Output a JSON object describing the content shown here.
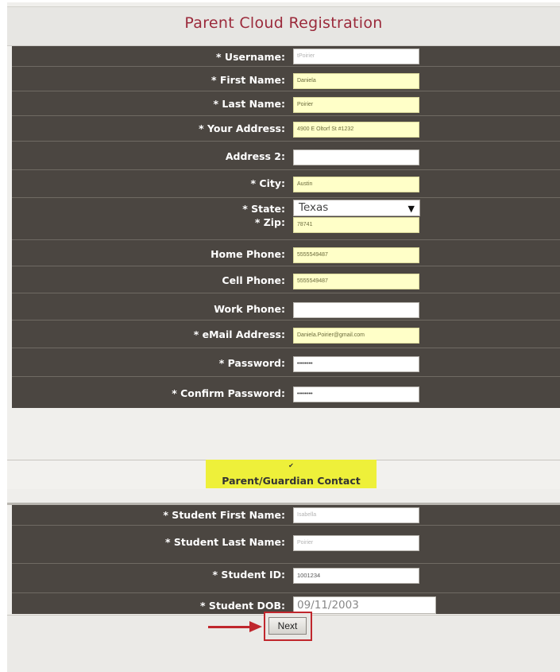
{
  "page": {
    "title": "Parent Cloud Registration"
  },
  "parent_fields": [
    {
      "label": "* Username:",
      "value": "tPoirier"
    },
    {
      "label": "* First Name:",
      "value": "Daniela"
    },
    {
      "label": "* Last Name:",
      "value": "Poirier"
    },
    {
      "label": "* Your Address:",
      "value": "4900 E Oltorf St #1232"
    },
    {
      "label": "Address 2:",
      "value": ""
    },
    {
      "label": "* City:",
      "value": "Austin"
    },
    {
      "label": "* State:",
      "value": "Texas"
    },
    {
      "label": "* Zip:",
      "value": "78741"
    },
    {
      "label": "Home Phone:",
      "value": "5555549487"
    },
    {
      "label": "Cell Phone:",
      "value": "5555549487"
    },
    {
      "label": "Work Phone:",
      "value": ""
    },
    {
      "label": "* eMail Address:",
      "value": "Daniela.Poirier@gmail.com"
    },
    {
      "label": "* Password:",
      "value": "••••••••"
    },
    {
      "label": "* Confirm Password:",
      "value": "••••••••"
    }
  ],
  "contact": {
    "checkbox_glyph": "✔",
    "label": "Parent/Guardian Contact"
  },
  "student_fields": [
    {
      "label": "* Student First Name:",
      "value": "Isabella"
    },
    {
      "label": "* Student Last Name:",
      "value": "Poirier"
    },
    {
      "label": "* Student ID:",
      "value": "1001234"
    },
    {
      "label": "* Student DOB:",
      "value": "09/11/2003"
    }
  ],
  "actions": {
    "next_label": "Next"
  },
  "colors": {
    "title": "#9b2a3b",
    "label_bg": "#4b4641",
    "highlight_field": "#ffffc8",
    "callout": "#c0272d",
    "contact_highlight": "#eef03a"
  },
  "icons": {
    "select_arrow": "▼"
  }
}
